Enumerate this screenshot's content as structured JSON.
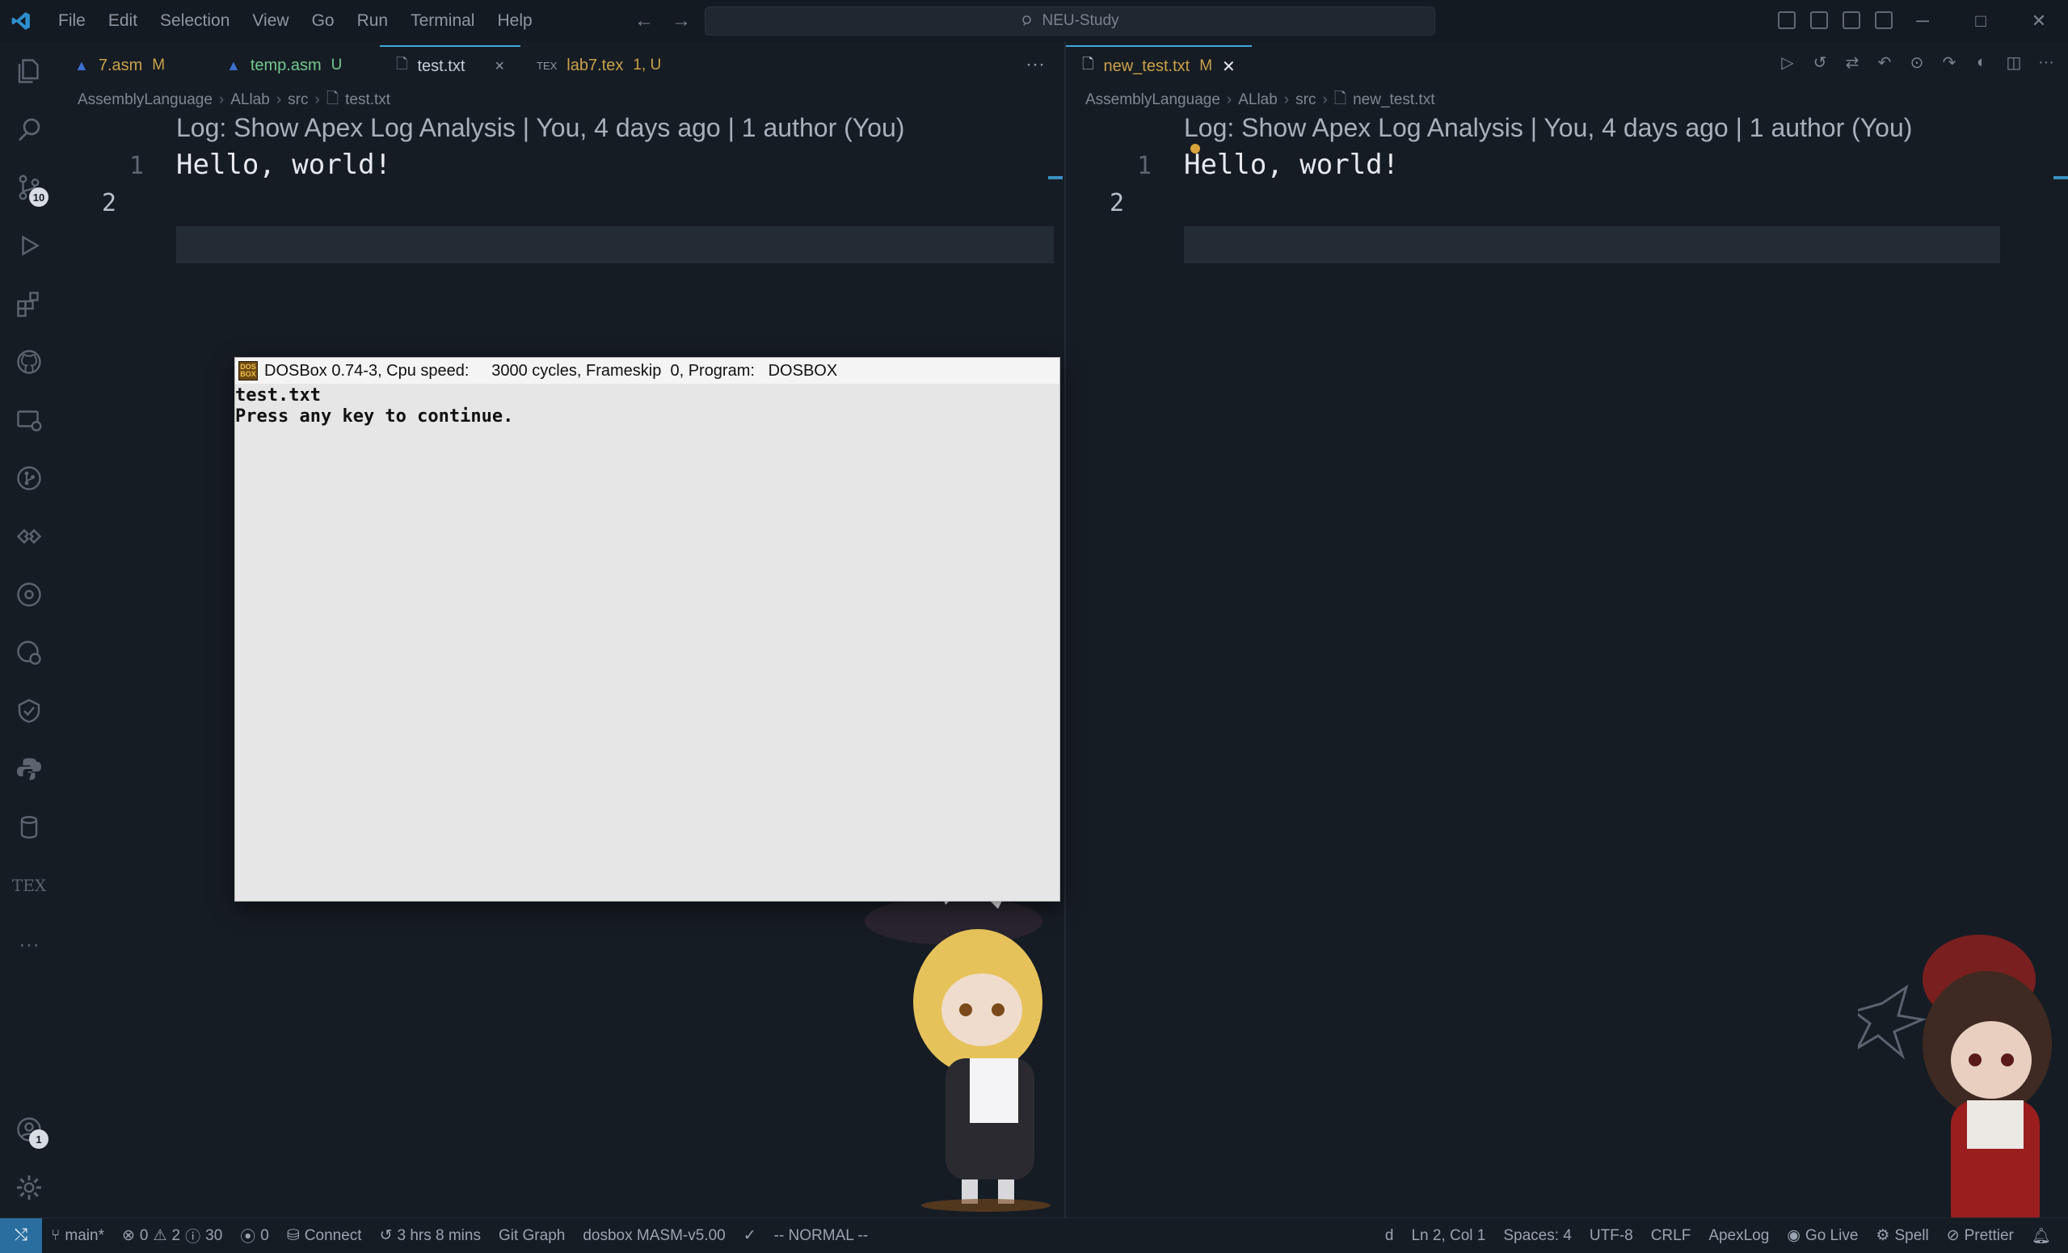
{
  "menu": [
    "File",
    "Edit",
    "Selection",
    "View",
    "Go",
    "Run",
    "Terminal",
    "Help"
  ],
  "search": {
    "label": "NEU-Study"
  },
  "activity": {
    "scm_badge": "10",
    "accounts_badge": "1",
    "tex_label": "TEX"
  },
  "left_group": {
    "tabs": [
      {
        "name": "7.asm",
        "status": "M"
      },
      {
        "name": "temp.asm",
        "status": "U"
      },
      {
        "name": "test.txt",
        "status": ""
      },
      {
        "name": "lab7.tex",
        "status": "1, U"
      }
    ],
    "breadcrumb": [
      "AssemblyLanguage",
      "ALlab",
      "src",
      "test.txt"
    ],
    "codelens": "Log: Show Apex Log Analysis | You, 4 days ago | 1 author (You)",
    "lines": [
      {
        "num": "1",
        "text": "Hello, world!"
      },
      {
        "num": "2",
        "text": ""
      }
    ]
  },
  "right_group": {
    "tabs": [
      {
        "name": "new_test.txt",
        "status": "M"
      }
    ],
    "breadcrumb": [
      "AssemblyLanguage",
      "ALlab",
      "src",
      "new_test.txt"
    ],
    "codelens": "Log: Show Apex Log Analysis | You, 4 days ago | 1 author (You)",
    "lines": [
      {
        "num": "1",
        "text": "Hello, world!"
      },
      {
        "num": "2",
        "text": ""
      }
    ]
  },
  "dosbox": {
    "title": "DOSBox 0.74-3, Cpu speed:     3000 cycles, Frameskip  0, Program:   DOSBOX",
    "logo": "DOS BOX",
    "lines": [
      "test.txt",
      "Press any key to continue."
    ]
  },
  "statusbar": {
    "branch": "main*",
    "errors": "0",
    "warnings": "2",
    "infos": "30",
    "ports": "0",
    "connect": "Connect",
    "time": "3 hrs 8 mins",
    "git_graph": "Git Graph",
    "dosbox": "dosbox MASM-v5.00",
    "mode": "-- NORMAL --",
    "d": "d",
    "position": "Ln 2, Col 1",
    "spaces": "Spaces: 4",
    "encoding": "UTF-8",
    "eol": "CRLF",
    "apexlog": "ApexLog",
    "golive": "Go Live",
    "spell": "Spell",
    "prettier": "Prettier"
  },
  "colors": {
    "accent": "#3fa9d8",
    "modified": "#c9a24a",
    "untracked": "#73c991",
    "background": "#161c24"
  }
}
